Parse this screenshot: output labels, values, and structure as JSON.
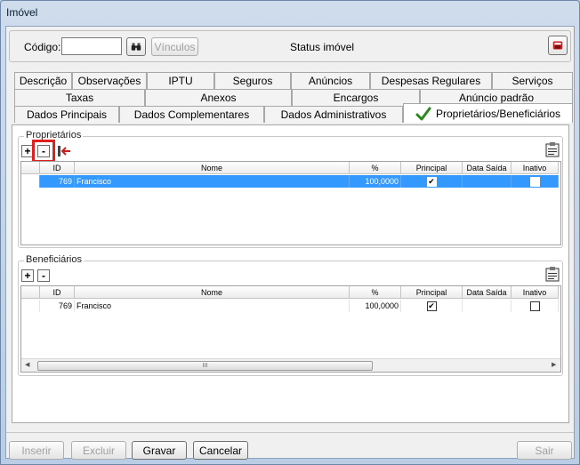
{
  "window": {
    "title": "Imóvel"
  },
  "header": {
    "codigo_label": "Código:",
    "codigo_value": "",
    "vinculos_label": "Vínculos",
    "status_label": "Status imóvel"
  },
  "tabs": {
    "row1": [
      "Descrição",
      "Observações",
      "IPTU",
      "Seguros",
      "Anúncios",
      "Despesas Regulares",
      "Serviços"
    ],
    "row2": [
      "Taxas",
      "Anexos",
      "Encargos",
      "Anúncio padrão"
    ],
    "row3": [
      "Dados Principais",
      "Dados Complementares",
      "Dados Administrativos",
      "Proprietários/Beneficiários"
    ]
  },
  "proprietarios": {
    "title": "Proprietários",
    "add_label": "+",
    "remove_label": "-",
    "columns": [
      "ID",
      "Nome",
      "%",
      "Principal",
      "Data Saída",
      "Inativo"
    ],
    "rows": [
      {
        "id": "769",
        "nome": "Francisco",
        "pct": "100,0000",
        "principal": "✔",
        "data_saida": "",
        "inativo": ""
      }
    ]
  },
  "beneficiarios": {
    "title": "Beneficiários",
    "add_label": "+",
    "remove_label": "-",
    "columns": [
      "ID",
      "Nome",
      "%",
      "Principal",
      "Data Saída",
      "Inativo"
    ],
    "rows": [
      {
        "id": "769",
        "nome": "Francisco",
        "pct": "100,0000",
        "principal": "✔",
        "data_saida": "",
        "inativo": ""
      }
    ],
    "scroll_left": "◀",
    "scroll_right": "▶",
    "scroll_grip": "III"
  },
  "footer": {
    "inserir": "Inserir",
    "excluir": "Excluir",
    "gravar": "Gravar",
    "cancelar": "Cancelar",
    "sair": "Sair"
  },
  "colors": {
    "selection": "#3399ff",
    "highlight_box": "#e02020",
    "check_green": "#2a8a1e"
  }
}
